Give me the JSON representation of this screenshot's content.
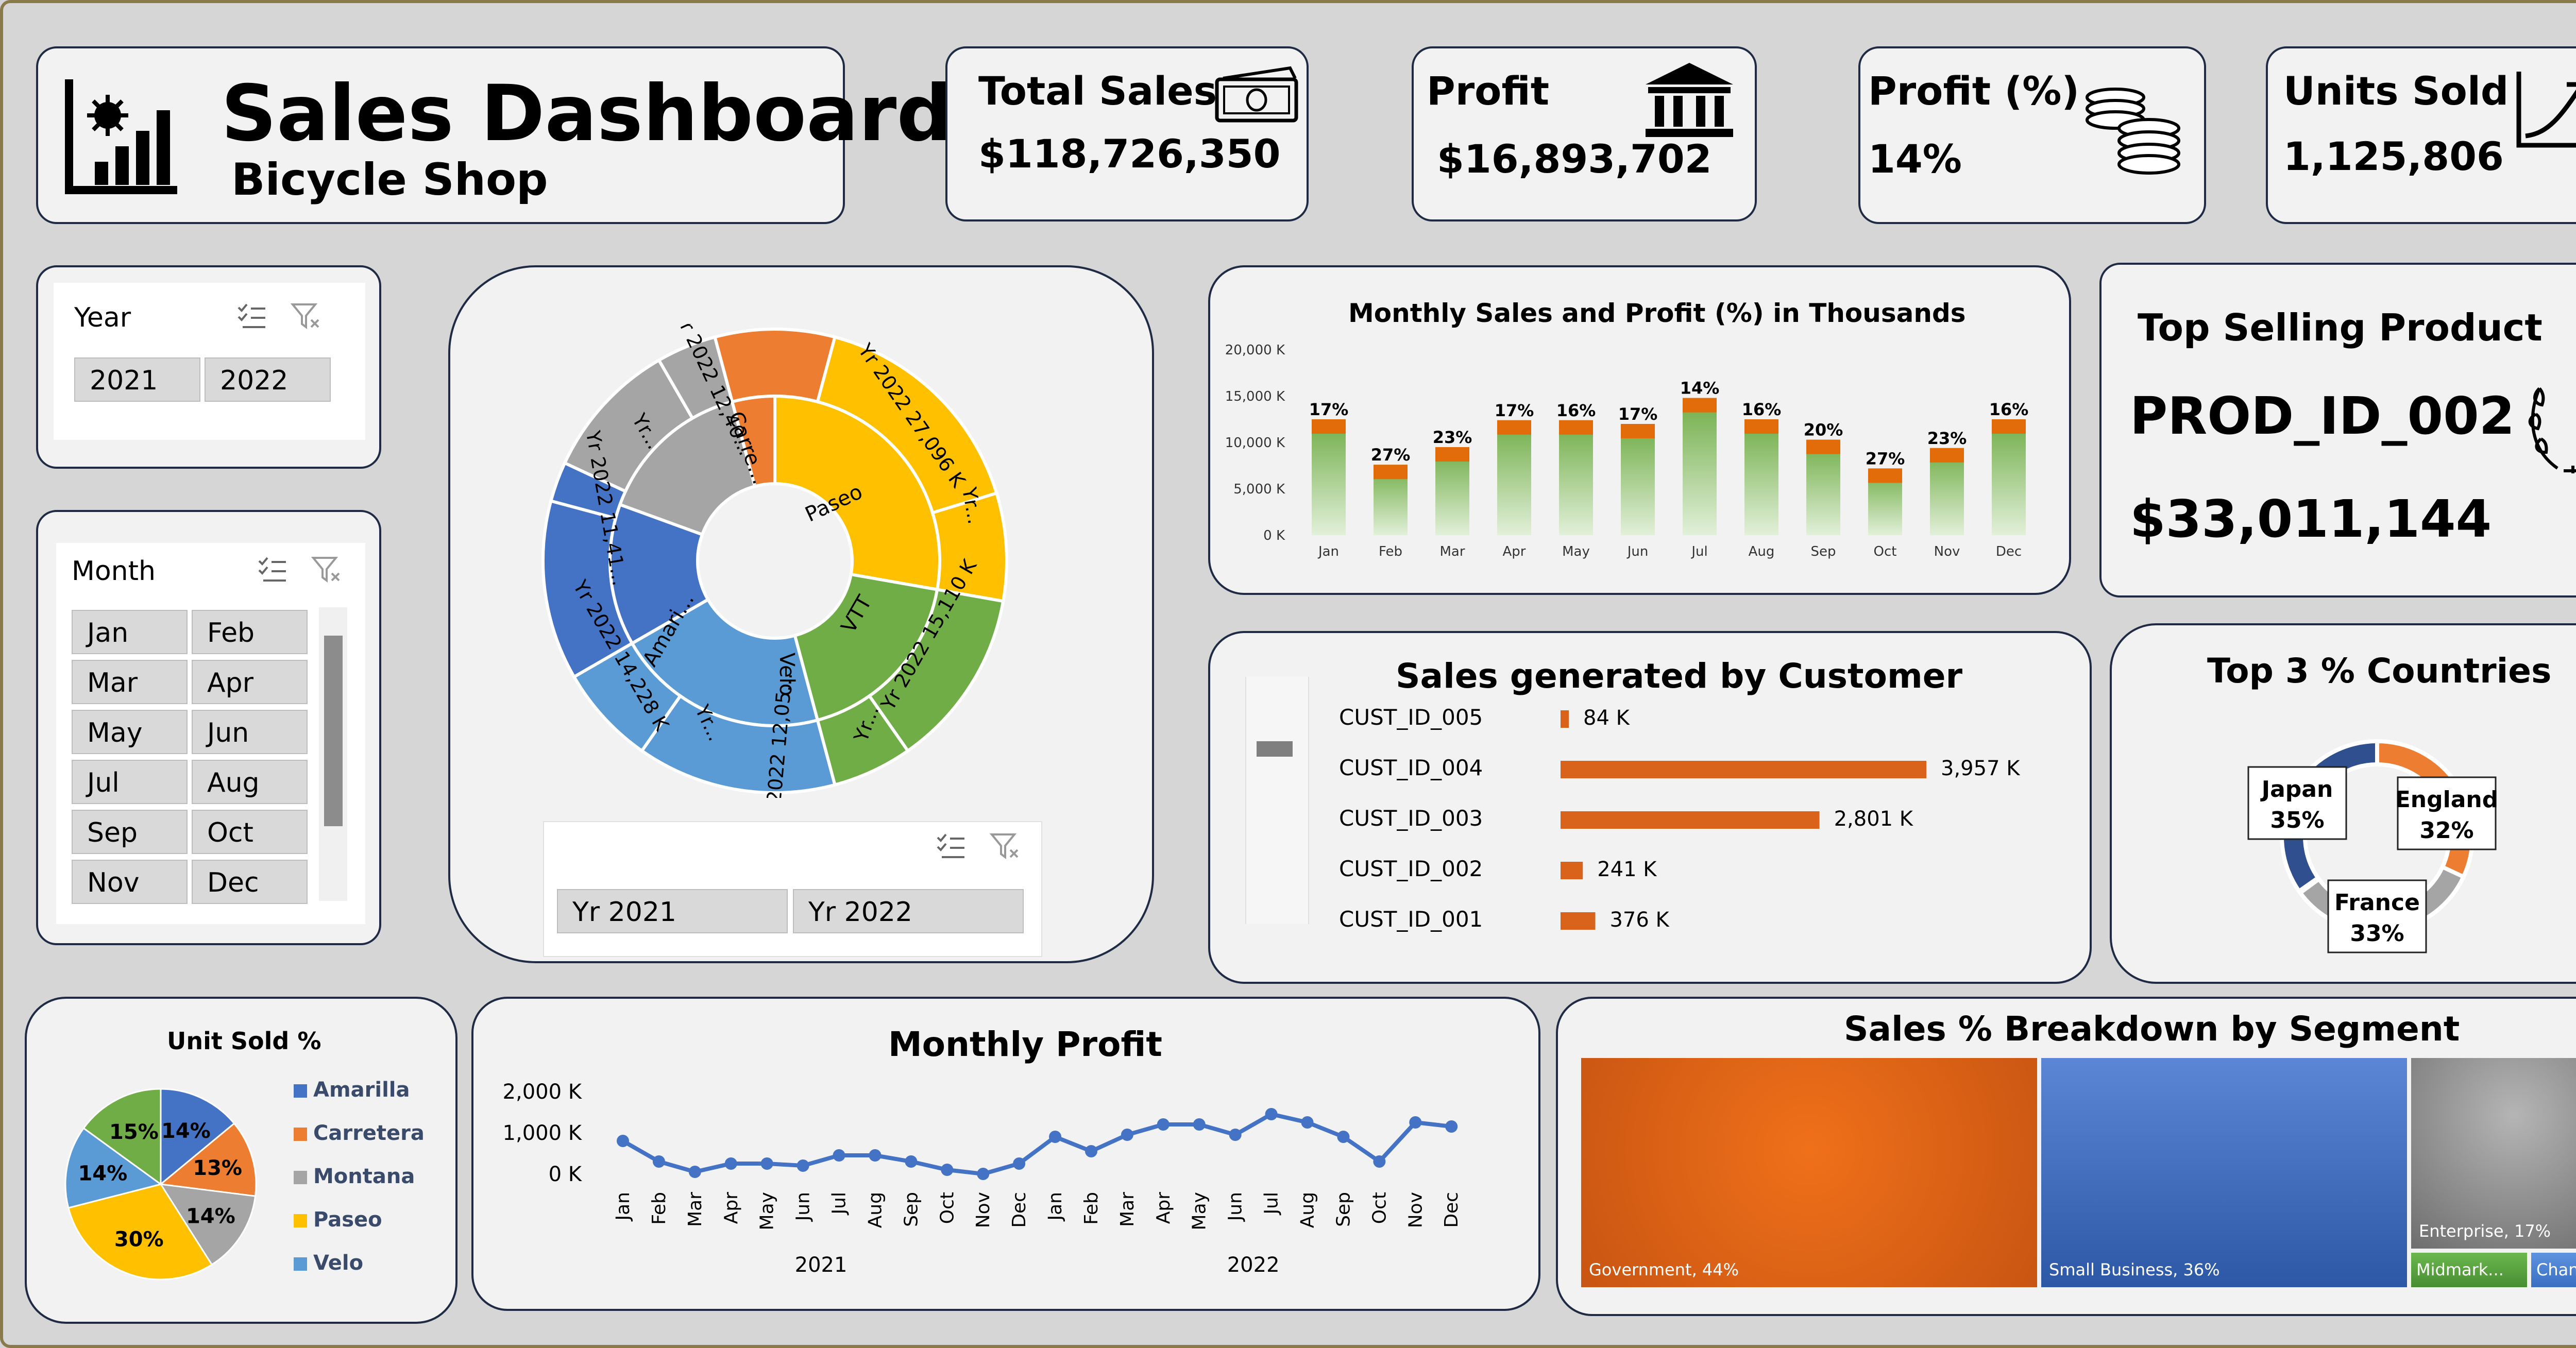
{
  "header": {
    "title": "Sales Dashboard",
    "subtitle": "Bicycle Shop"
  },
  "kpis": {
    "total_sales": {
      "label": "Total Sales",
      "value": "$118,726,350"
    },
    "profit": {
      "label": "Profit",
      "value": "$16,893,702"
    },
    "profit_pct": {
      "label": "Profit (%)",
      "value": "14%"
    },
    "units_sold": {
      "label": "Units Sold",
      "value": "1,125,806"
    }
  },
  "year_slicer": {
    "title": "Year",
    "options": [
      "2021",
      "2022"
    ]
  },
  "month_slicer": {
    "title": "Month",
    "options": [
      "Jan",
      "Feb",
      "Mar",
      "Apr",
      "May",
      "Jun",
      "Jul",
      "Aug",
      "Sep",
      "Oct",
      "Nov",
      "Dec"
    ]
  },
  "sunburst": {
    "inner": [
      {
        "label": "Paseo",
        "color": "#ffc000"
      },
      {
        "label": "VTT",
        "color": "#70ad47"
      },
      {
        "label": "Velo",
        "color": "#5b9bd5"
      },
      {
        "label": "Amari...",
        "color": "#4472c4"
      },
      {
        "label": "",
        "color": "#a5a5a5"
      },
      {
        "label": "Carre...",
        "color": "#ed7d31"
      }
    ],
    "outer_labels": [
      "Yr 2022 27,096 K",
      "Yr...",
      "Yr 2022 15,110 K",
      "Yr...",
      "Yr 2022 12,05...",
      "Yr...",
      "Yr 2022 14,228 K",
      "Yr 2022 11,41...",
      "Yr...",
      "Yr 2022 12,40..."
    ],
    "slicer_options": [
      "Yr 2021",
      "Yr 2022"
    ]
  },
  "monthly_sales": {
    "title": "Monthly Sales and Profit (%) in Thousands",
    "colors": {
      "bar": "#70ad47",
      "cap": "#e36c0a"
    }
  },
  "top_product": {
    "title": "Top Selling Product",
    "product": "PROD_ID_002",
    "value": "$33,011,144"
  },
  "customers": {
    "title": "Sales generated by Customer",
    "rows": [
      {
        "name": "CUST_ID_005",
        "label": "84 K"
      },
      {
        "name": "CUST_ID_004",
        "label": "3,957 K"
      },
      {
        "name": "CUST_ID_003",
        "label": "2,801 K"
      },
      {
        "name": "CUST_ID_002",
        "label": "241 K"
      },
      {
        "name": "CUST_ID_001",
        "label": "376 K"
      }
    ]
  },
  "countries": {
    "title": "Top 3 % Countries",
    "items": [
      {
        "name": "Japan",
        "pct": "35%",
        "color": "#2f4f8f"
      },
      {
        "name": "England",
        "pct": "32%",
        "color": "#ed7d31"
      },
      {
        "name": "France",
        "pct": "33%",
        "color": "#a5a5a5"
      }
    ]
  },
  "unit_sold": {
    "title": "Unit Sold %"
  },
  "monthly_profit": {
    "title": "Monthly Profit",
    "years": [
      "2021",
      "2022"
    ]
  },
  "segments": {
    "title": "Sales % Breakdown by Segment",
    "items": [
      {
        "label": "Government, 44%",
        "color": "#e8651a"
      },
      {
        "label": "Small Business, 36%",
        "color": "#3a66b8"
      },
      {
        "label": "Enterprise, 17%",
        "color": "#8c8c8c"
      },
      {
        "label": "Midmark...",
        "color": "#5aa043"
      },
      {
        "label": "Chann...",
        "color": "#4a80d0"
      }
    ]
  },
  "chart_data": [
    {
      "type": "bar",
      "title": "Monthly Sales and Profit (%) in Thousands",
      "categories": [
        "Jan",
        "Feb",
        "Mar",
        "Apr",
        "May",
        "Jun",
        "Jul",
        "Aug",
        "Sep",
        "Oct",
        "Nov",
        "Dec"
      ],
      "series": [
        {
          "name": "Sales",
          "values": [
            12500,
            7600,
            9500,
            12400,
            12400,
            12000,
            14800,
            12500,
            10300,
            7200,
            9400,
            12500
          ]
        }
      ],
      "data_labels": [
        "17%",
        "27%",
        "23%",
        "17%",
        "16%",
        "17%",
        "14%",
        "16%",
        "20%",
        "27%",
        "23%",
        "16%"
      ],
      "yticks": [
        "0 K",
        "5,000 K",
        "10,000 K",
        "15,000 K",
        "20,000 K"
      ],
      "ylim": [
        0,
        20000
      ]
    },
    {
      "type": "bar",
      "title": "Sales generated by Customer",
      "categories": [
        "CUST_ID_005",
        "CUST_ID_004",
        "CUST_ID_003",
        "CUST_ID_002",
        "CUST_ID_001"
      ],
      "values": [
        84,
        3957,
        2801,
        241,
        376
      ]
    },
    {
      "type": "pie",
      "title": "Top 3 % Countries",
      "categories": [
        "Japan",
        "England",
        "France"
      ],
      "values": [
        35,
        32,
        33
      ]
    },
    {
      "type": "pie",
      "title": "Unit Sold %",
      "categories": [
        "Amarilla",
        "Carretera",
        "Montana",
        "Paseo",
        "Velo",
        "VTT"
      ],
      "values": [
        14,
        13,
        14,
        30,
        14,
        15
      ],
      "legend": [
        "Amarilla",
        "Carretera",
        "Montana",
        "Paseo",
        "Velo"
      ],
      "colors": [
        "#4472c4",
        "#ed7d31",
        "#a5a5a5",
        "#ffc000",
        "#5b9bd5",
        "#70ad47"
      ]
    },
    {
      "type": "line",
      "title": "Monthly Profit",
      "x": [
        "Jan",
        "Feb",
        "Mar",
        "Apr",
        "May",
        "Jun",
        "Jul",
        "Aug",
        "Sep",
        "Oct",
        "Nov",
        "Dec",
        "Jan",
        "Feb",
        "Mar",
        "Apr",
        "May",
        "Jun",
        "Jul",
        "Aug",
        "Sep",
        "Oct",
        "Nov",
        "Dec"
      ],
      "groups": [
        "2021",
        "2022"
      ],
      "values": [
        800,
        300,
        50,
        250,
        250,
        200,
        450,
        450,
        300,
        100,
        0,
        250,
        900,
        550,
        950,
        1200,
        1200,
        950,
        1450,
        1250,
        900,
        300,
        1250,
        1150
      ],
      "yticks": [
        "0 K",
        "1,000 K",
        "2,000 K"
      ],
      "ylim": [
        0,
        2000
      ]
    },
    {
      "type": "treemap",
      "title": "Sales % Breakdown by Segment",
      "categories": [
        "Government",
        "Small Business",
        "Enterprise",
        "Midmarket",
        "Channel Partners"
      ],
      "values": [
        44,
        36,
        17,
        2,
        1
      ]
    }
  ]
}
